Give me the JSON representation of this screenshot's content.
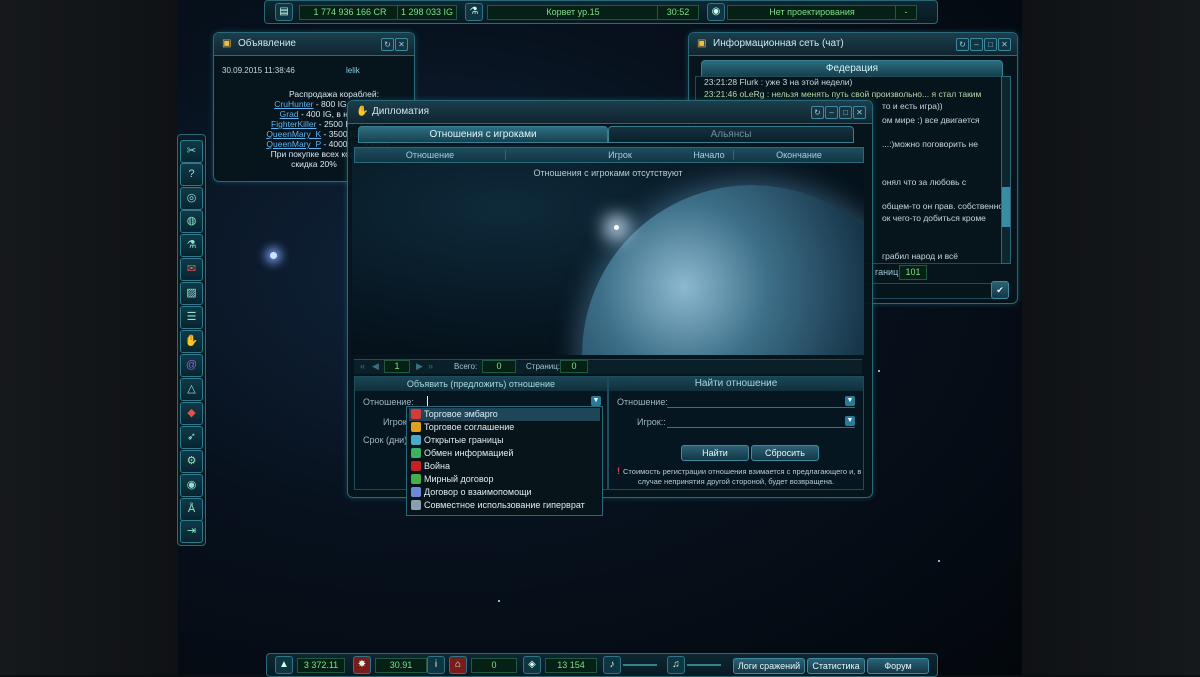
{
  "top_bar": {
    "credits": "1 774 936 166 CR",
    "ig": "1 298 033 IG",
    "ship": "Корвет ур.15",
    "time": "30:52",
    "status": "Нет проектирования",
    "status_extra": "-"
  },
  "bottom_bar": {
    "v1": "3 372.11",
    "v2": "30.91",
    "v3": "0",
    "v4": "13 154",
    "btn_logs": "Логи сражений",
    "btn_stats": "Статистика",
    "btn_forum": "Форум"
  },
  "announcement": {
    "title": "Объявление",
    "date": "30.09.2015 11:38:46",
    "author": "lelik",
    "heading": "Распродажа кораблей:",
    "items": [
      {
        "name": "CruHunter",
        "text": "- 800 IG, в налич"
      },
      {
        "name": "Grad",
        "text": "- 400 IG, в наличии"
      },
      {
        "name": "FighterKiller",
        "text": "- 2500 IG, в нали"
      },
      {
        "name": "QueenMary_K",
        "text": "- 3500 IG, в нали"
      },
      {
        "name": "QueenMary_P",
        "text": "- 4000 IG, в нали"
      }
    ],
    "footer1": "При покупке всех кораблей о",
    "footer2": "скидка 20%"
  },
  "chat": {
    "title": "Информационная сеть (чат)",
    "tab": "Федерация",
    "lines": [
      "23:21:28  Flurk : уже 3 на этой недели)",
      "23:21:46  oLeRg : нельзя менять путь свой произвольно... я стал таким",
      "то и есть игра))",
      "ом мире :) все двигается",
      "...:)можно поговорить не",
      "онял что за любовь с",
      "общем-то он прав. собственно",
      "ок чего-то добиться кроме",
      "грабил народ и всё"
    ],
    "count_label": "ганиц:",
    "count": "101"
  },
  "diplomacy": {
    "title": "Дипломатия",
    "tab_players": "Отношения с игроками",
    "tab_alliances": "Альянсы",
    "columns": [
      "Отношение",
      "Игрок",
      "Начало",
      "Окончание"
    ],
    "empty_text": "Отношения с игроками отсутствуют",
    "pager": {
      "page": "1",
      "total_label": "Всего:",
      "total": "0",
      "pages_label": "Страниц:",
      "pages": "0"
    },
    "declare_title": "Объявить (предложить) отношение",
    "find_title": "Найти отношение",
    "label_relation": "Отношение:",
    "label_player": "Игрок:",
    "label_term": "Срок (дни):",
    "find_label_relation": "Отношение:",
    "find_label_player": "Игрок::",
    "btn_find": "Найти",
    "btn_reset": "Сбросить",
    "note_line1": "Стоимость регистрации отношения взимается с предлагающего и, в",
    "note_line2": "случае непринятия другой стороной, будет возвращена.",
    "dropdown": [
      {
        "label": "Торговое эмбарго",
        "color": "#d63a3a"
      },
      {
        "label": "Торговое соглашение",
        "color": "#e0a020"
      },
      {
        "label": "Открытые границы",
        "color": "#4aa8c8"
      },
      {
        "label": "Обмен информацией",
        "color": "#3cb060"
      },
      {
        "label": "Война",
        "color": "#c82020"
      },
      {
        "label": "Мирный договор",
        "color": "#48b048"
      },
      {
        "label": "Договор о взаимопомощи",
        "color": "#6a8ad8"
      },
      {
        "label": "Совместное использование гиперврат",
        "color": "#8aa0b0"
      }
    ]
  },
  "sidebar": {
    "icons": [
      "tools-icon",
      "help-icon",
      "coins-icon",
      "planet-icon",
      "flask-icon",
      "mail-icon",
      "chart-icon",
      "chat-icon",
      "handshake-icon",
      "spiral-icon",
      "alliance-icon",
      "faction-icon",
      "fleet-icon",
      "settings-icon",
      "eye-icon",
      "academy-icon",
      "exit-icon"
    ]
  }
}
